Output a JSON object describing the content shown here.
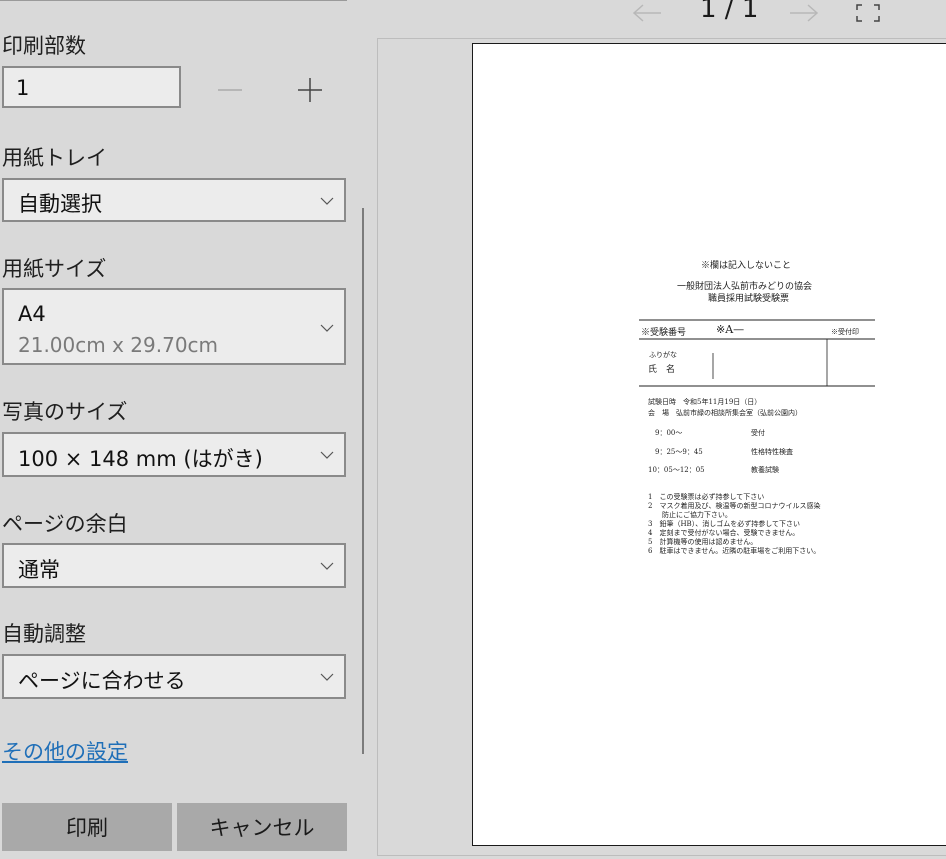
{
  "settings": {
    "copies_label": "印刷部数",
    "copies_value": "1",
    "tray_label": "用紙トレイ",
    "tray_value": "自動選択",
    "size_label": "用紙サイズ",
    "size_value": "A4",
    "size_detail": "21.00cm x 29.70cm",
    "photo_label": "写真のサイズ",
    "photo_value": "100 × 148 mm (はがき)",
    "margin_label": "ページの余白",
    "margin_value": "通常",
    "fit_label": "自動調整",
    "fit_value": "ページに合わせる",
    "more_settings_link": "その他の設定",
    "print_button": "印刷",
    "cancel_button": "キャンセル"
  },
  "preview": {
    "page_indicator": "1 / 1",
    "icons": [
      "arrow-left-icon",
      "arrow-right-icon",
      "fullscreen-icon"
    ],
    "document": {
      "note": "※欄は記入しないこと",
      "org": "一般財団法人弘前市みどりの協会",
      "title": "職員採用試験受験票",
      "exam_no_label": "※受験番号",
      "exam_no_value": "※A—",
      "stamp_label": "※受付印",
      "furigana_label": "ふりがな",
      "name_label": "氏　名",
      "date_line": "試験日時　令和5年11月19日（日）",
      "venue_line": "会　場　弘前市緑の相談所集会室（弘前公園内）",
      "schedule": [
        {
          "time": "9：00～",
          "event": "受付"
        },
        {
          "time": "9：25～9：45",
          "event": "性格特性検査"
        },
        {
          "time": "10：05～12：05",
          "event": "教養試験"
        }
      ],
      "notes": [
        "1　この受験票は必ず持参して下さい",
        "2　マスク着用及び、検温等の新型コロナウイルス感染",
        "　　防止にご協力下さい。",
        "3　鉛筆（HB）、消しゴムを必ず持参して下さい",
        "4　定刻まで受付がない場合、受験できません。",
        "5　計算機等の使用は認めません。",
        "6　駐車はできません。近隣の駐車場をご利用下さい。"
      ]
    }
  }
}
